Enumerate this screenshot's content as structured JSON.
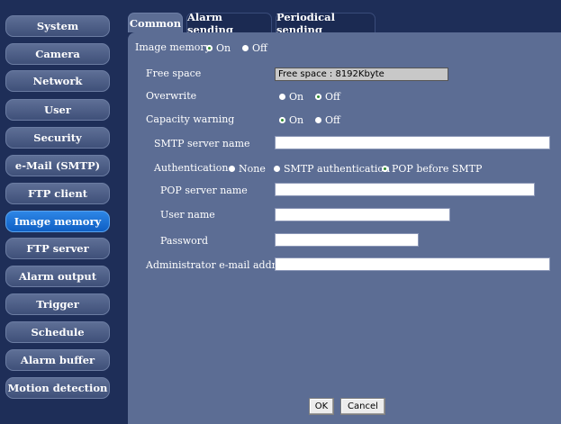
{
  "sidebar": {
    "items": [
      {
        "label": "System"
      },
      {
        "label": "Camera"
      },
      {
        "label": "Network"
      },
      {
        "label": "User"
      },
      {
        "label": "Security"
      },
      {
        "label": "e-Mail (SMTP)"
      },
      {
        "label": "FTP client"
      },
      {
        "label": "Image memory"
      },
      {
        "label": "FTP server"
      },
      {
        "label": "Alarm output"
      },
      {
        "label": "Trigger"
      },
      {
        "label": "Schedule"
      },
      {
        "label": "Alarm buffer"
      },
      {
        "label": "Motion detection"
      }
    ],
    "active_index": 7
  },
  "tabs": [
    {
      "label": "Common"
    },
    {
      "label": "Alarm sending"
    },
    {
      "label": "Periodical sending"
    }
  ],
  "form": {
    "image_memory": {
      "label": "Image memory",
      "on": "On",
      "off": "Off",
      "selected": "On"
    },
    "free_space": {
      "label": "Free space",
      "value": "Free space : 8192Kbyte"
    },
    "overwrite": {
      "label": "Overwrite",
      "on": "On",
      "off": "Off",
      "selected": "Off"
    },
    "capacity_warning": {
      "label": "Capacity warning",
      "on": "On",
      "off": "Off",
      "selected": "On"
    },
    "smtp_server": {
      "label": "SMTP server name",
      "value": ""
    },
    "authentication": {
      "label": "Authentication",
      "options": [
        "None",
        "SMTP authentication",
        "POP before SMTP"
      ],
      "selected": "POP before SMTP"
    },
    "pop_server": {
      "label": "POP server name",
      "value": ""
    },
    "user_name": {
      "label": "User name",
      "value": ""
    },
    "password": {
      "label": "Password",
      "value": ""
    },
    "admin_email": {
      "label": "Administrator e-mail address",
      "value": ""
    }
  },
  "buttons": {
    "ok": "OK",
    "cancel": "Cancel"
  },
  "colors": {
    "background": "#1e2e58",
    "panel": "#5c6d94",
    "active_nav": "#1a73d8",
    "radio_selected": "#2e8b2e"
  }
}
